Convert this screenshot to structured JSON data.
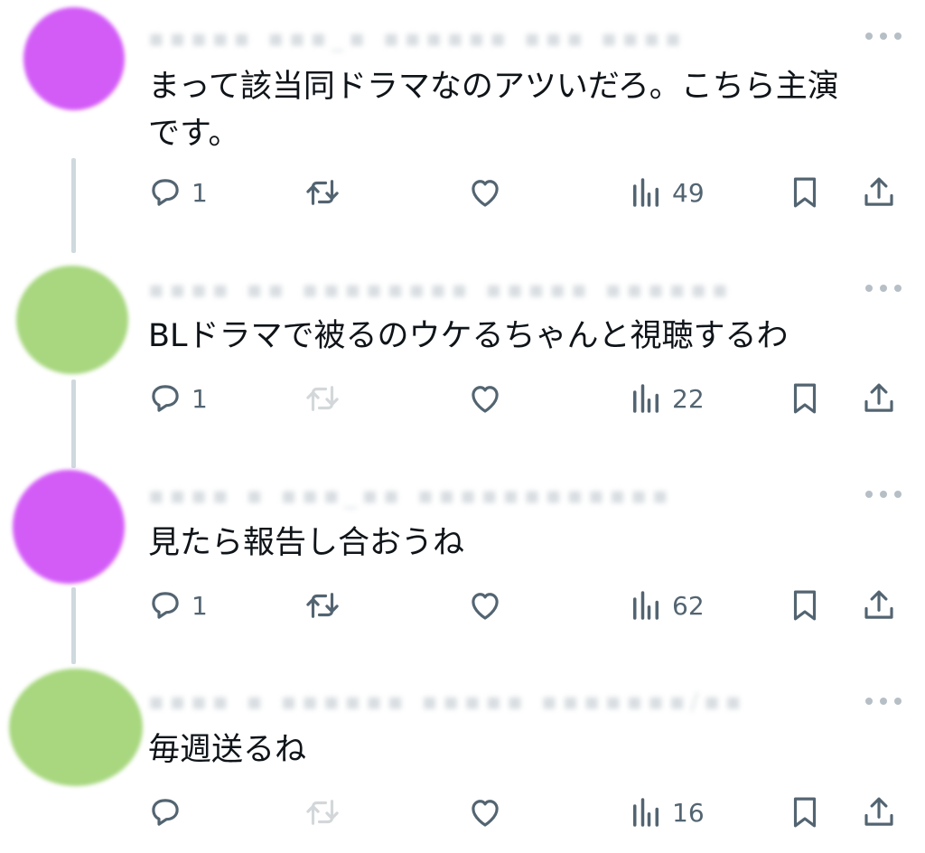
{
  "posts": [
    {
      "avatar_color": "#d35cf7",
      "text_lines": [
        "まって該当同ドラマなのアツいだろ。こちら主演",
        "です。"
      ],
      "replies": "1",
      "views": "49",
      "retweet_disabled": false
    },
    {
      "avatar_color": "#a8d77f",
      "text_lines": [
        "BLドラマで被るのウケるちゃんと視聴するわ"
      ],
      "replies": "1",
      "views": "22",
      "retweet_disabled": true
    },
    {
      "avatar_color": "#d35cf7",
      "text_lines": [
        "見たら報告し合おうね"
      ],
      "replies": "1",
      "views": "62",
      "retweet_disabled": false
    },
    {
      "avatar_color": "#a8d77f",
      "text_lines": [
        "毎週送るね"
      ],
      "replies": "",
      "views": "16",
      "retweet_disabled": true
    }
  ],
  "icons": {
    "reply": "reply-icon",
    "retweet": "retweet-icon",
    "like": "like-icon",
    "views": "views-icon",
    "bookmark": "bookmark-icon",
    "share": "share-icon",
    "more": "more-icon"
  }
}
